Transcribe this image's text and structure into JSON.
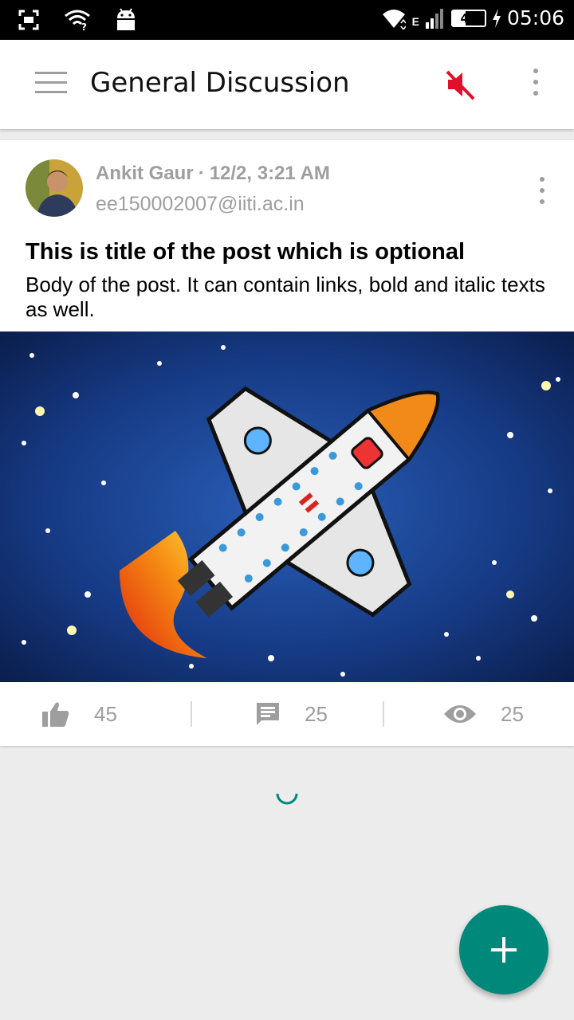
{
  "status_bar": {
    "time": "05:06",
    "battery_level": "41",
    "network_type": "E",
    "icons": [
      "screenshot-icon",
      "wifi-question-icon",
      "android-icon",
      "wifi-icon",
      "signal-icon",
      "battery-icon",
      "charging-icon"
    ]
  },
  "app_bar": {
    "title": "General Discussion",
    "menu_icon": "hamburger-menu-icon",
    "mute_icon": "volume-off-icon",
    "mute_color": "#e0102a",
    "overflow_icon": "more-vert-icon"
  },
  "post": {
    "author": "Ankit Gaur",
    "separator": "·",
    "timestamp": "12/2, 3:21 AM",
    "email": "ee150002007@iiti.ac.in",
    "title": "This is title of the post which is optional",
    "body": "Body of the post. It can contain links, bold and italic texts as well.",
    "image_description": "cartoon space shuttle on starry background",
    "likes": "45",
    "comments": "25",
    "views": "25"
  },
  "fab": {
    "icon": "plus-icon",
    "color": "#00897b"
  },
  "accent": "#00897b"
}
